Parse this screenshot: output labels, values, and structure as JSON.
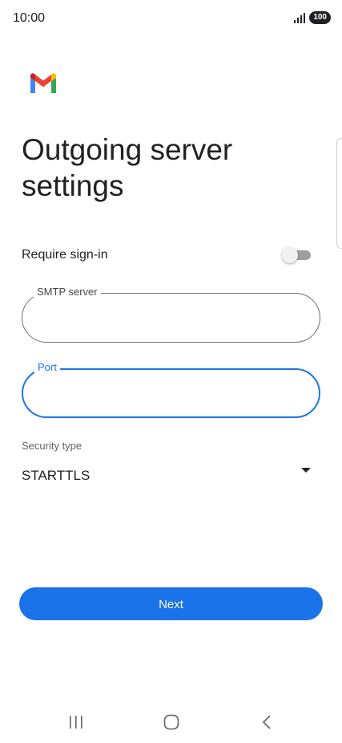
{
  "status_bar": {
    "time": "10:00",
    "battery": "100",
    "signal_icon": "signal-icon"
  },
  "app": {
    "logo_icon": "gmail-logo-icon"
  },
  "page": {
    "title": "Outgoing server settings"
  },
  "require_signin": {
    "label": "Require sign-in",
    "enabled": false
  },
  "smtp_field": {
    "label": "SMTP server",
    "value": ""
  },
  "port_field": {
    "label": "Port",
    "value": "",
    "focused": true
  },
  "security": {
    "label": "Security type",
    "value": "STARTTLS",
    "icon": "dropdown-arrow-icon"
  },
  "next_button": {
    "label": "Next"
  },
  "nav_bar": {
    "recent_icon": "recent-apps-icon",
    "home_icon": "home-icon",
    "back_icon": "back-icon"
  },
  "colors": {
    "accent": "#1a73e8",
    "text": "#202124",
    "outline": "#6f6f6f"
  }
}
